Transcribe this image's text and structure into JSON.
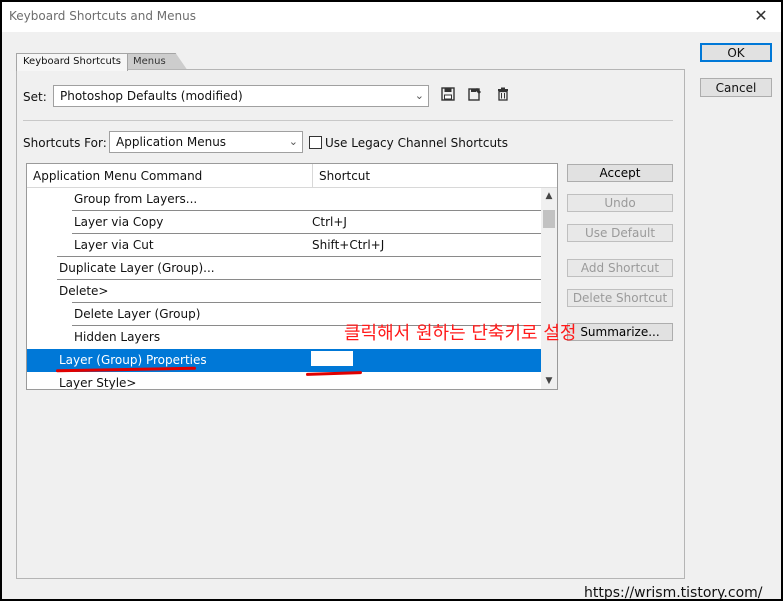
{
  "window": {
    "title": "Keyboard Shortcuts and Menus",
    "close_glyph": "✕"
  },
  "dialog_buttons": {
    "ok": "OK",
    "cancel": "Cancel"
  },
  "tabs": [
    {
      "label": "Keyboard Shortcuts"
    },
    {
      "label": "Menus"
    }
  ],
  "set": {
    "label": "Set:",
    "value": "Photoshop Defaults (modified)",
    "icons": [
      "save-set-icon",
      "save-as-set-icon",
      "delete-set-icon"
    ]
  },
  "shortcuts_for": {
    "label": "Shortcuts For:",
    "value": "Application Menus"
  },
  "legacy": {
    "label": "Use Legacy Channel Shortcuts",
    "checked": false
  },
  "table": {
    "headers": [
      "Application Menu Command",
      "Shortcut"
    ],
    "rows": [
      {
        "command": "Group from Layers...",
        "shortcut": "",
        "indent": 2
      },
      {
        "command": "Layer via Copy",
        "shortcut": "Ctrl+J",
        "indent": 2
      },
      {
        "command": "Layer via Cut",
        "shortcut": "Shift+Ctrl+J",
        "indent": 2
      },
      {
        "command": "Duplicate Layer (Group)...",
        "shortcut": "",
        "indent": 1
      },
      {
        "command": "Delete>",
        "shortcut": "",
        "indent": 1
      },
      {
        "command": "Delete Layer (Group)",
        "shortcut": "",
        "indent": 2
      },
      {
        "command": "Hidden Layers",
        "shortcut": "",
        "indent": 2
      },
      {
        "command": "Layer (Group) Properties",
        "shortcut": "",
        "indent": 1,
        "selected": true
      },
      {
        "command": "Layer Style>",
        "shortcut": "",
        "indent": 1
      }
    ]
  },
  "side_buttons": {
    "accept": "Accept",
    "undo": "Undo",
    "use_default": "Use Default",
    "add_shortcut": "Add Shortcut",
    "delete_shortcut": "Delete Shortcut",
    "summarize": "Summarize..."
  },
  "annotation": "클릭해서 원하는 단축키로 설정",
  "watermark": "https://wrism.tistory.com/",
  "colors": {
    "selection": "#0078d7",
    "annotation": "#ff1a1a"
  }
}
